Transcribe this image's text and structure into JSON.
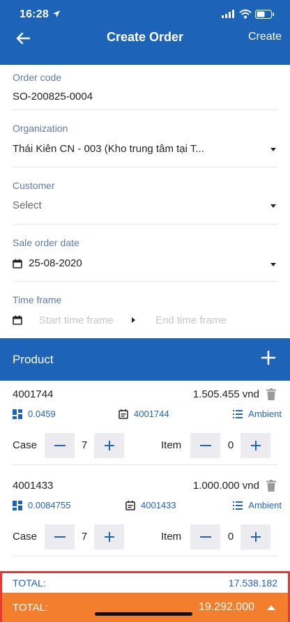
{
  "status": {
    "time": "16:28"
  },
  "header": {
    "title": "Create Order",
    "create_label": "Create"
  },
  "form": {
    "order_code": {
      "label": "Order code",
      "value": "SO-200825-0004"
    },
    "organization": {
      "label": "Organization",
      "value": "Thái Kiên CN - 003  (Kho trung tâm tại T..."
    },
    "customer": {
      "label": "Customer",
      "placeholder": "Select"
    },
    "sale_order_date": {
      "label": "Sale order date",
      "value": "25-08-2020"
    },
    "time_frame": {
      "label": "Time frame",
      "start_placeholder": "Start time frame",
      "end_placeholder": "End time frame"
    }
  },
  "product_section": {
    "title": "Product"
  },
  "products": [
    {
      "code": "4001744",
      "price": "1.505.455 vnd",
      "volume": "0.0459",
      "sku": "4001744",
      "storage": "Ambient",
      "case_label": "Case",
      "case_qty": "7",
      "item_label": "Item",
      "item_qty": "0"
    },
    {
      "code": "4001433",
      "price": "1.000.000 vnd",
      "volume": "0.0084755",
      "sku": "4001433",
      "storage": "Ambient",
      "case_label": "Case",
      "case_qty": "7",
      "item_label": "Item",
      "item_qty": "0"
    }
  ],
  "totals": {
    "subtotal_label": "TOTAL:",
    "subtotal_value": "17.538.182",
    "total_label": "TOTAL:",
    "total_value": "19.292.000"
  },
  "colors": {
    "primary": "#1d63b8",
    "accent_orange": "#f37e2e",
    "highlight_red": "#e53935",
    "label_blue": "#5d7aa8"
  }
}
